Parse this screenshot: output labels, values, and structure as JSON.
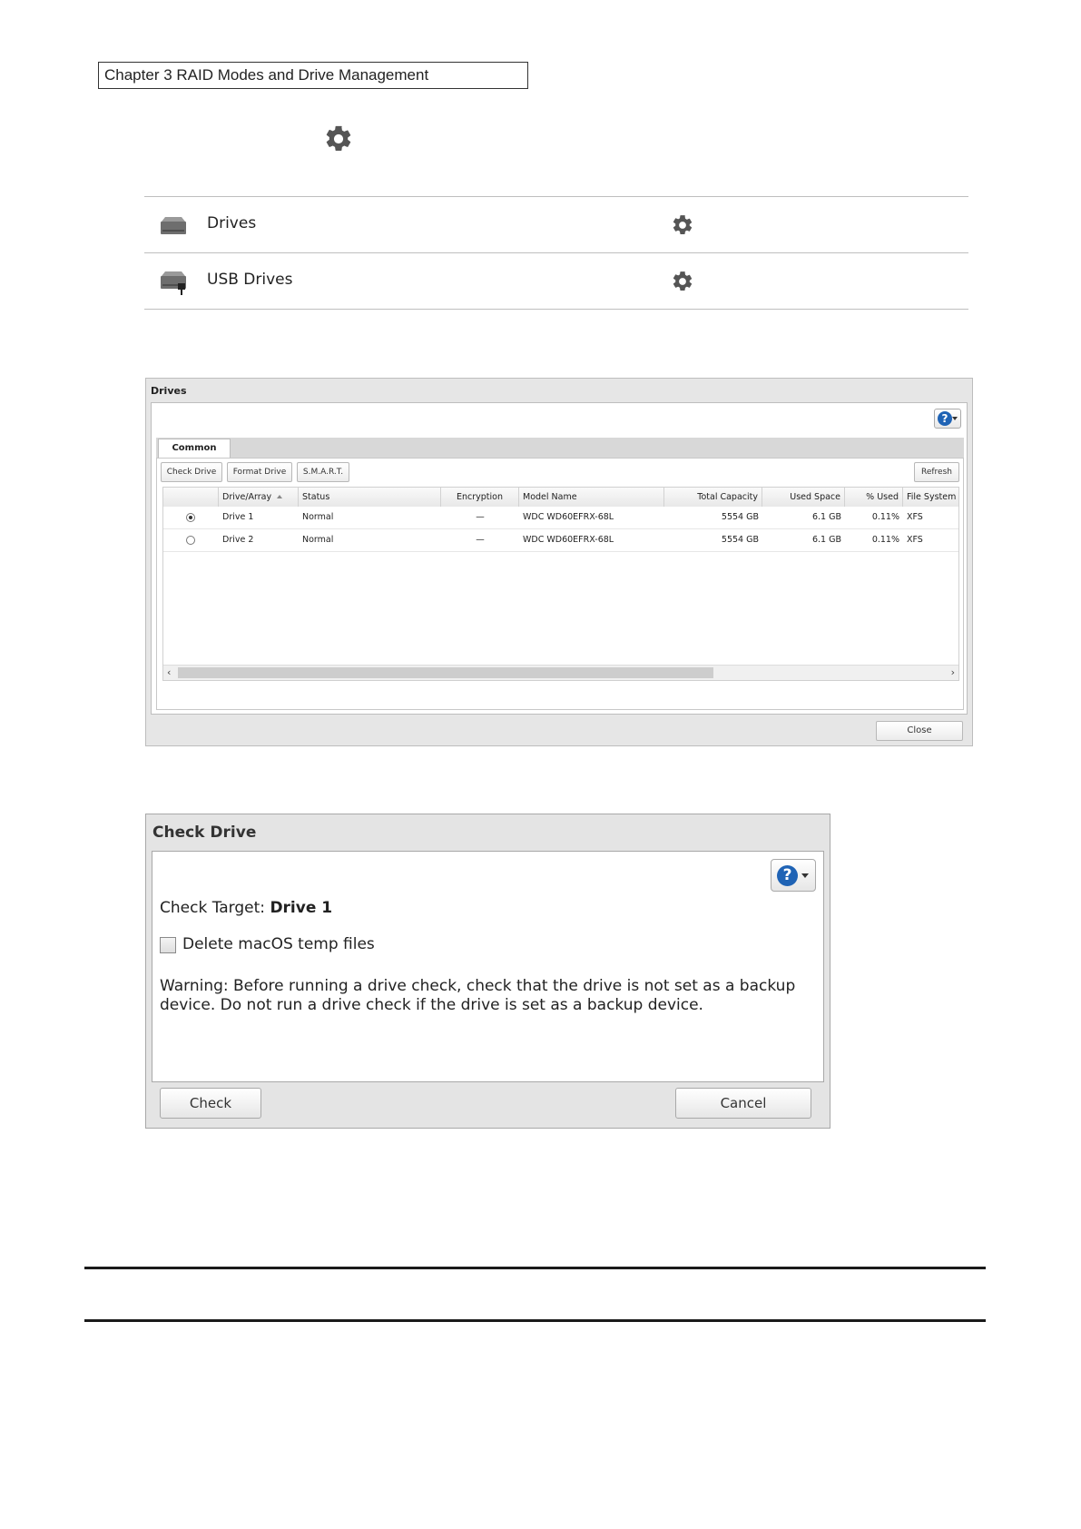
{
  "chapter_header": "Chapter 3 RAID Modes and Drive Management",
  "icons": {
    "settings": "gear-icon",
    "drive": "drive-icon",
    "usb_drive": "usb-drive-icon",
    "help": "help-icon"
  },
  "menu": {
    "items": [
      {
        "label": "Drives"
      },
      {
        "label": "USB Drives"
      }
    ]
  },
  "drives_window": {
    "title": "Drives",
    "tab": "Common",
    "toolbar": {
      "check_drive": "Check Drive",
      "format_drive": "Format Drive",
      "smart": "S.M.A.R.T.",
      "refresh": "Refresh"
    },
    "columns": [
      "Drive/Array",
      "Status",
      "Encryption",
      "Model Name",
      "Total Capacity",
      "Used Space",
      "% Used",
      "File System"
    ],
    "rows": [
      {
        "selected": true,
        "drive": "Drive 1",
        "status": "Normal",
        "encryption": "—",
        "model": "WDC WD60EFRX-68L",
        "total": "5554 GB",
        "used": "6.1 GB",
        "pct": "0.11%",
        "fs": "XFS"
      },
      {
        "selected": false,
        "drive": "Drive 2",
        "status": "Normal",
        "encryption": "—",
        "model": "WDC WD60EFRX-68L",
        "total": "5554 GB",
        "used": "6.1 GB",
        "pct": "0.11%",
        "fs": "XFS"
      }
    ],
    "close_label": "Close"
  },
  "check_dialog": {
    "title": "Check Drive",
    "target_label": "Check Target:",
    "target_value": "Drive 1",
    "checkbox_label": "Delete macOS temp files",
    "checkbox_checked": false,
    "warning": "Warning: Before running a drive check, check that the drive is not set as a backup device. Do not run a drive check if the drive is set as a backup device.",
    "check_button": "Check",
    "cancel_button": "Cancel"
  }
}
